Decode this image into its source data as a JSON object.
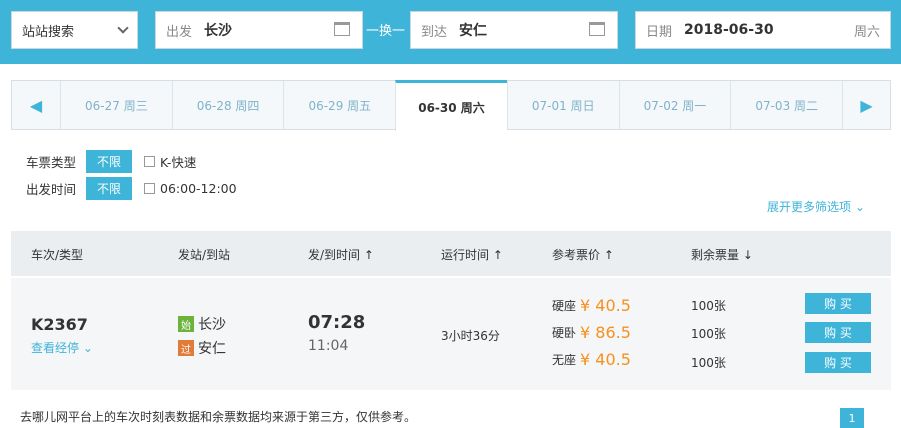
{
  "search": {
    "type_label": "站站搜索",
    "from_label": "出发",
    "from_value": "长沙",
    "swap_label": "换",
    "to_label": "到达",
    "to_value": "安仁",
    "date_label": "日期",
    "date_value": "2018-06-30",
    "weekday": "周六"
  },
  "dates": [
    "06-27 周三",
    "06-28 周四",
    "06-29 周五",
    "06-30 周六",
    "07-01 周日",
    "07-02 周一",
    "07-03 周二"
  ],
  "filters": [
    {
      "name": "车票类型",
      "tag": "不限",
      "option": "K-快速"
    },
    {
      "name": "出发时间",
      "tag": "不限",
      "option": "06:00-12:00"
    }
  ],
  "more_filters": "展开更多筛选项",
  "table_header": {
    "train": "车次/类型",
    "stations": "发站/到站",
    "times": "发/到时间 ↑",
    "duration": "运行时间 ↑",
    "price": "参考票价 ↑",
    "remaining": "剩余票量 ↓"
  },
  "row": {
    "train": "K2367",
    "route": "查看经停",
    "from_badge": "始",
    "from": "长沙",
    "to_badge": "过",
    "to": "安仁",
    "depart": "07:28",
    "arrive": "11:04",
    "duration": "3小时36分",
    "seats": [
      {
        "type": "硬座",
        "price": "¥ 40.5",
        "remain": "100张",
        "buy": "购 买"
      },
      {
        "type": "硬卧",
        "price": "¥ 86.5",
        "remain": "100张",
        "buy": "购 买"
      },
      {
        "type": "无座",
        "price": "¥ 40.5",
        "remain": "100张",
        "buy": "购 买"
      }
    ]
  },
  "footer": "去哪儿网平台上的车次时刻表数据和余票数据均来源于第三方，仅供参考。",
  "page": "1"
}
